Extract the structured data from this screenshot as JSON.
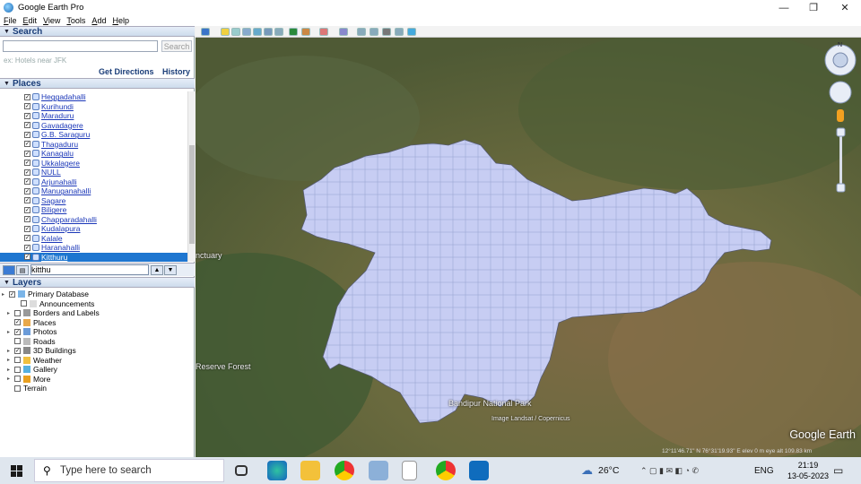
{
  "window": {
    "title": "Google Earth Pro",
    "controls": [
      "—",
      "❐",
      "✕"
    ]
  },
  "menu": [
    "File",
    "Edit",
    "View",
    "Tools",
    "Add",
    "Help"
  ],
  "search": {
    "header": "Search",
    "input_value": "",
    "button": "Search",
    "hint": "ex: Hotels near JFK",
    "links": [
      "Get Directions",
      "History"
    ]
  },
  "places": {
    "header": "Places",
    "items": [
      "Heggadahalli",
      "Kurihundi",
      "Maraduru",
      "Gavadagere",
      "G.B. Saraguru",
      "Thagaduru",
      "Kanagalu",
      "Ukkalagere",
      "NULL",
      "Arjunahalli",
      "Manuganahalli",
      "Sagare",
      "Biligere",
      "Chapparadahalli",
      "Kudalapura",
      "Kalale",
      "Haranahalli",
      "Kitthuru"
    ],
    "selected": "Kitthuru",
    "find_value": "kitthu"
  },
  "layers": {
    "header": "Layers",
    "items": [
      "Primary Database",
      "Announcements",
      "Borders and Labels",
      "Places",
      "Photos",
      "Roads",
      "3D Buildings",
      "Weather",
      "Gallery",
      "More",
      "Terrain"
    ]
  },
  "map": {
    "labels": {
      "sanctuary": "nctuary",
      "reserve": "Reserve Forest",
      "park": "Bandipur National Park",
      "credit": "Image Landsat / Copernicus"
    },
    "status": "12°11'46.71\" N   76°31'19.93\" E   elev   0 m      eye alt 109.83 km",
    "logo": "Google Earth"
  },
  "taskbar": {
    "search_placeholder": "Type here to search",
    "weather": "26°C",
    "lang": "ENG",
    "time": "21:19",
    "date": "13-05-2023"
  }
}
